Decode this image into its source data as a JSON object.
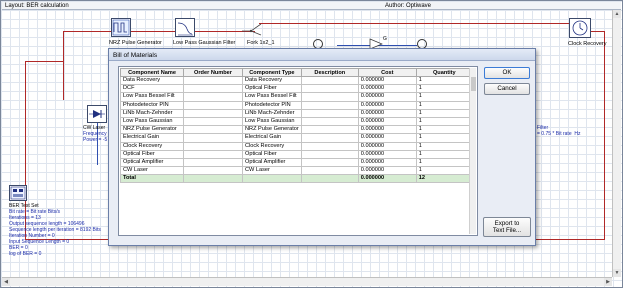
{
  "layout": {
    "title": "Layout: BER calculation",
    "author": "Author: Optiwave"
  },
  "components": {
    "nrz_generator": "NRZ Pulse Generator",
    "lp_gaussian_filter": "Low Pass Gaussian Filter",
    "fork": "Fork 1x2_1",
    "clock_recovery": "Clock Recovery",
    "gain_label": "G",
    "cw_laser": {
      "name": "CW Laser",
      "line1": "Frequency",
      "line2": "Power = -5"
    },
    "filter_props": "Filter\n= 0.75 * Bit rate  Hz",
    "ber_test_set": {
      "name": "BER Test Set",
      "lines": [
        "Bit rate = Bit rate  Bits/s",
        "Iterations = 13",
        "Output sequence length = 106496",
        "Sequence length per iteration = 8192  Bits",
        "Iteration Number = 0",
        "Input Sequence Length = 0",
        "BER = 0",
        "log of BER = 0"
      ]
    }
  },
  "dialog": {
    "title": "Bill of Materials",
    "columns": [
      "Component Name",
      "Order Number",
      "Component Type",
      "Description",
      "Cost",
      "Quantity"
    ],
    "rows": [
      [
        "Data Recovery",
        "",
        "Data Recovery",
        "",
        "0.000000",
        "1"
      ],
      [
        "DCF",
        "",
        "Optical Fiber",
        "",
        "0.000000",
        "1"
      ],
      [
        "Low Pass Bessel Filt",
        "",
        "Low Pass Bessel Filt",
        "",
        "0.000000",
        "1"
      ],
      [
        "Photodetector PIN",
        "",
        "Photodetector PIN",
        "",
        "0.000000",
        "1"
      ],
      [
        "LiNb Mach-Zehnder",
        "",
        "LiNb Mach-Zehnder",
        "",
        "0.000000",
        "1"
      ],
      [
        "Low Pass Gaussian",
        "",
        "Low Pass Gaussian",
        "",
        "0.000000",
        "1"
      ],
      [
        "NRZ Pulse Generator",
        "",
        "NRZ Pulse Generator",
        "",
        "0.000000",
        "1"
      ],
      [
        "Electrical Gain",
        "",
        "Electrical Gain",
        "",
        "0.000000",
        "1"
      ],
      [
        "Clock Recovery",
        "",
        "Clock Recovery",
        "",
        "0.000000",
        "1"
      ],
      [
        "Optical Fiber",
        "",
        "Optical Fiber",
        "",
        "0.000000",
        "1"
      ],
      [
        "Optical Amplifier",
        "",
        "Optical Amplifier",
        "",
        "0.000000",
        "1"
      ],
      [
        "CW Laser",
        "",
        "CW Laser",
        "",
        "0.000000",
        "1"
      ]
    ],
    "total": [
      "Total",
      "",
      "",
      "",
      "0.000000",
      "12"
    ],
    "buttons": {
      "ok": "OK",
      "cancel": "Cancel",
      "export": "Export to\nText File..."
    }
  },
  "colors": {
    "wire_red": "#b02828",
    "wire_blue": "#3050b0",
    "total_row": "#d6ecd2",
    "property_text": "#1a2aa8"
  }
}
